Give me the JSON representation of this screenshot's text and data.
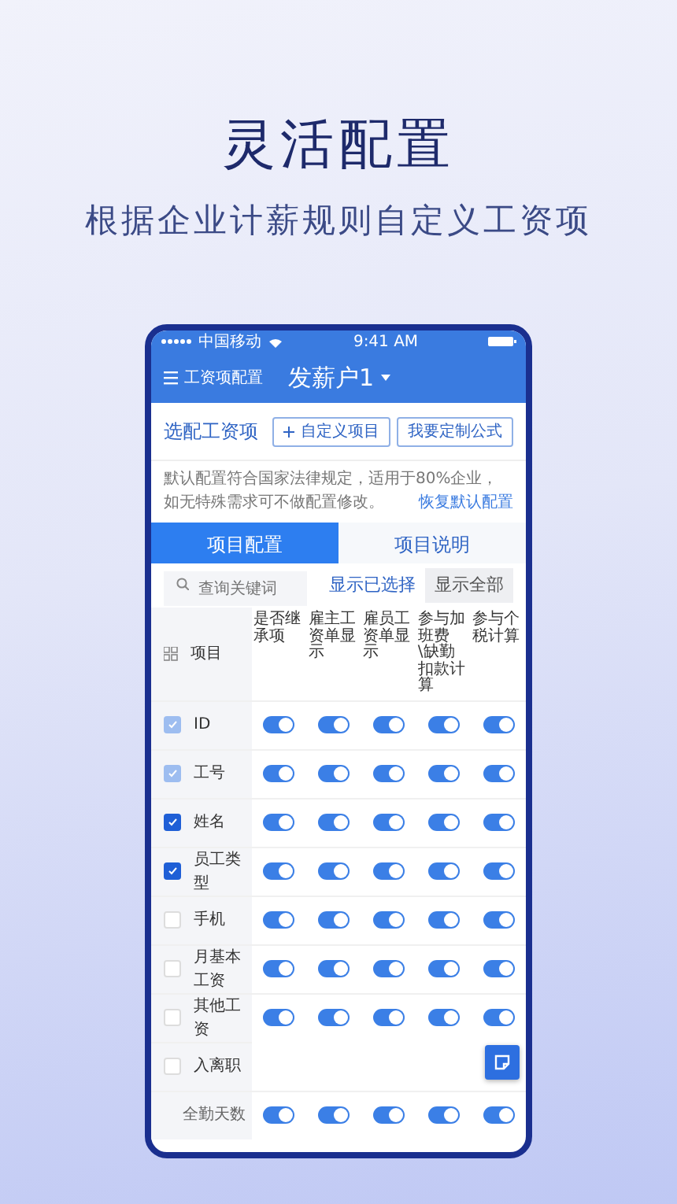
{
  "headline": "灵活配置",
  "subtitle": "根据企业计薪规则自定义工资项",
  "status_bar": {
    "carrier": "中国移动",
    "time": "9:41 AM"
  },
  "header": {
    "menu_label": "工资项配置",
    "title": "发薪户1"
  },
  "section": {
    "title": "选配工资项",
    "buttons": [
      {
        "label": "自定义项目",
        "kind": "add"
      },
      {
        "label": "我要定制公式",
        "kind": "plain"
      }
    ]
  },
  "notice": {
    "text": "默认配置符合国家法律规定，适用于80%企业，如无特殊需求可不做配置修改。",
    "link": "恢复默认配置"
  },
  "tabs": [
    {
      "label": "项目配置",
      "selected": true
    },
    {
      "label": "项目说明",
      "selected": false
    }
  ],
  "search": {
    "placeholder": "查询关键词"
  },
  "filters": [
    {
      "label": "显示已选择",
      "selected": true
    },
    {
      "label": "显示全部",
      "selected": false
    }
  ],
  "table": {
    "first_column": "项目",
    "columns": [
      "是否继承项",
      "雇主工资单显示",
      "雇员工资单显示",
      "参与加班费\\缺勤扣款计算",
      "参与个税计算"
    ],
    "rows": [
      {
        "kind": "item",
        "label": "ID",
        "checked": true,
        "disabled": true,
        "toggles": [
          true,
          true,
          true,
          true,
          true
        ]
      },
      {
        "kind": "item",
        "label": "工号",
        "checked": true,
        "disabled": true,
        "toggles": [
          true,
          true,
          true,
          true,
          true
        ]
      },
      {
        "kind": "item",
        "label": "姓名",
        "checked": true,
        "disabled": false,
        "toggles": [
          true,
          true,
          true,
          true,
          true
        ]
      },
      {
        "kind": "item",
        "label": "员工类型",
        "checked": true,
        "disabled": false,
        "toggles": [
          true,
          true,
          true,
          true,
          true
        ]
      },
      {
        "kind": "item",
        "label": "手机",
        "checked": false,
        "disabled": false,
        "toggles": [
          true,
          true,
          true,
          true,
          true
        ]
      },
      {
        "kind": "item",
        "label": "月基本工资",
        "checked": false,
        "disabled": false,
        "toggles": [
          true,
          true,
          true,
          true,
          true
        ]
      },
      {
        "kind": "item",
        "label": "其他工资",
        "checked": false,
        "disabled": false,
        "toggles": [
          true,
          true,
          true,
          true,
          true
        ]
      },
      {
        "kind": "item",
        "label": "入离职",
        "checked": false,
        "disabled": false
      },
      {
        "kind": "sub",
        "label": "全勤天数",
        "toggles": [
          true,
          true,
          true,
          true,
          true
        ]
      }
    ]
  }
}
